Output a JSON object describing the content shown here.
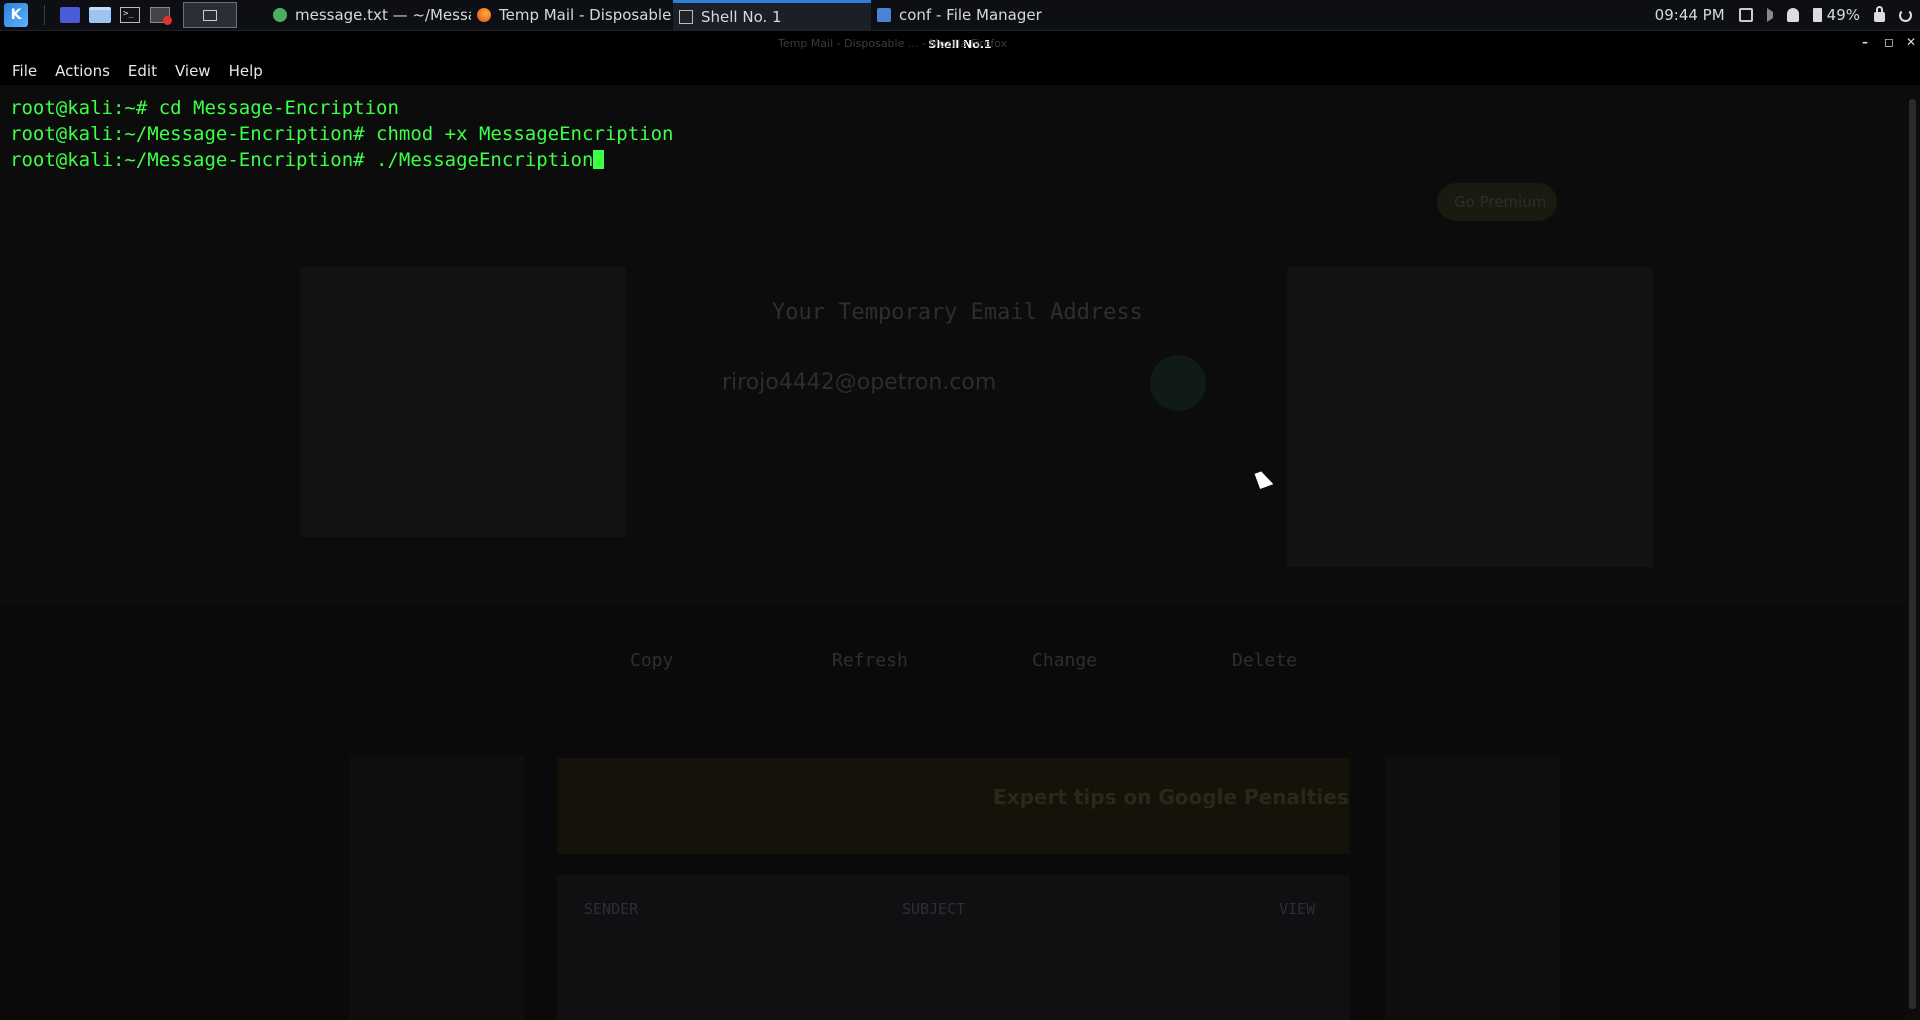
{
  "panel": {
    "tasks": [
      {
        "label": "message.txt — ~/Messa...",
        "icon": "text-editor-icon"
      },
      {
        "label": "Temp Mail - Disposable ...",
        "icon": "firefox-icon"
      },
      {
        "label": "Shell No. 1",
        "icon": "terminal-icon"
      },
      {
        "label": "conf - File Manager",
        "icon": "folder-icon"
      }
    ],
    "clock": "09:44 PM",
    "battery": "49%"
  },
  "window": {
    "title": "Shell No.1",
    "ghost_title": "Temp Mail - Disposable ... - Mozilla Firefox"
  },
  "menu": [
    "File",
    "Actions",
    "Edit",
    "View",
    "Help"
  ],
  "terminal": {
    "lines": [
      "root@kali:~# cd Message-Encription",
      "root@kali:~/Message-Encription# chmod +x MessageEncription",
      "root@kali:~/Message-Encription# ./MessageEncription"
    ]
  },
  "background_page": {
    "heading": "Your Temporary Email Address",
    "email": "rirojo4442@opetron.com",
    "actions": [
      "Copy",
      "Refresh",
      "Change",
      "Delete"
    ],
    "table_headers": [
      "SENDER",
      "SUBJECT",
      "VIEW"
    ],
    "ad_text": "Expert tips on Google Penalties",
    "premium": "Go Premium"
  }
}
